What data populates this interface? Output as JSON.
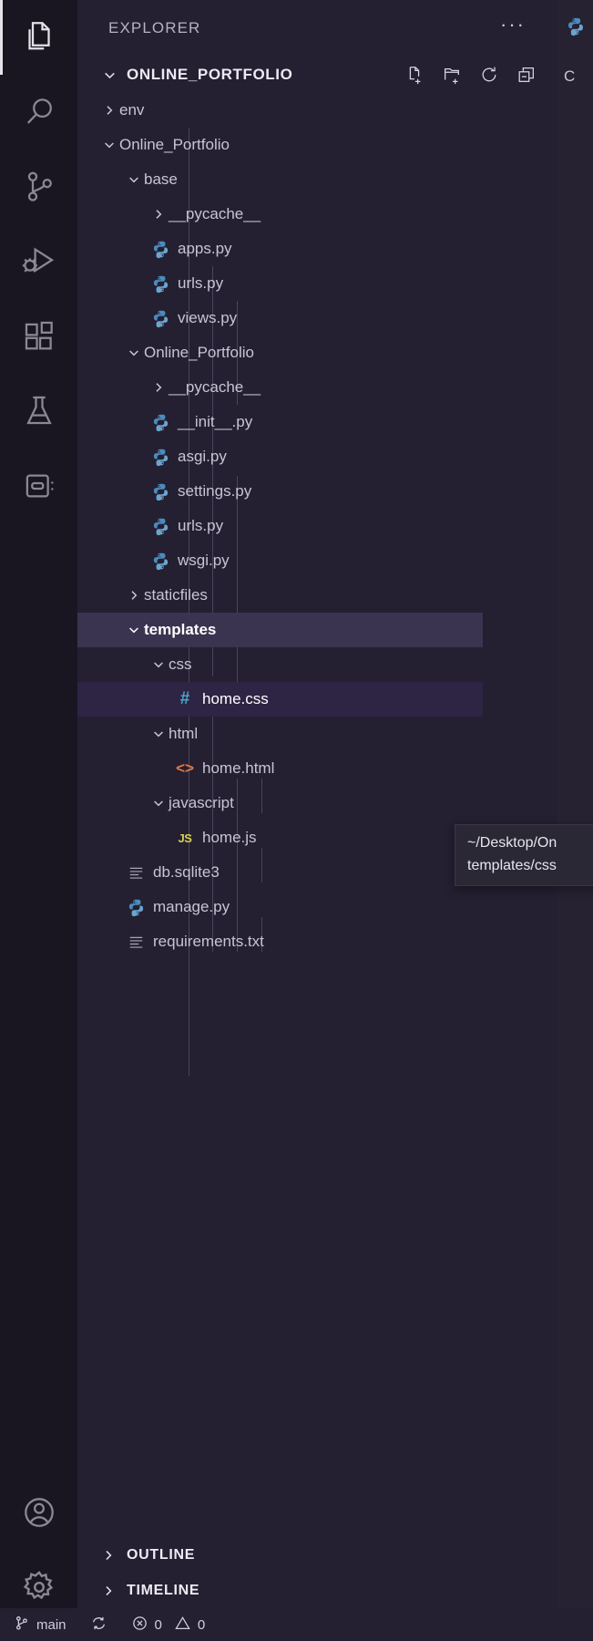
{
  "activitybar": {
    "items": [
      {
        "name": "explorer",
        "icon": "files-icon",
        "active": true
      },
      {
        "name": "search",
        "icon": "search-icon",
        "active": false
      },
      {
        "name": "source-control",
        "icon": "source-control-icon",
        "active": false
      },
      {
        "name": "run-and-debug",
        "icon": "run-debug-icon",
        "active": false
      },
      {
        "name": "extensions",
        "icon": "extensions-icon",
        "active": false
      },
      {
        "name": "testing",
        "icon": "beaker-icon",
        "active": false
      },
      {
        "name": "remote-explorer",
        "icon": "remote-explorer-icon",
        "active": false
      }
    ],
    "bottom": [
      {
        "name": "accounts",
        "icon": "account-icon"
      },
      {
        "name": "manage",
        "icon": "gear-icon"
      }
    ]
  },
  "sidebar": {
    "title": "EXPLORER",
    "more_actions": "···",
    "folder_section": {
      "label": "ONLINE_PORTFOLIO",
      "expanded": true,
      "actions": [
        {
          "name": "new-file-button",
          "icon": "new-file-icon"
        },
        {
          "name": "new-folder-button",
          "icon": "new-folder-icon"
        },
        {
          "name": "refresh-button",
          "icon": "refresh-icon"
        },
        {
          "name": "collapse-all-button",
          "icon": "collapse-all-icon"
        }
      ]
    },
    "tree": [
      {
        "label": "env",
        "type": "folder",
        "expanded": false,
        "depth": 1,
        "icon": "chevron-right-icon"
      },
      {
        "label": "Online_Portfolio",
        "type": "folder",
        "expanded": true,
        "depth": 1,
        "icon": "chevron-down-icon"
      },
      {
        "label": "base",
        "type": "folder",
        "expanded": true,
        "depth": 2,
        "icon": "chevron-down-icon"
      },
      {
        "label": "__pycache__",
        "type": "folder",
        "expanded": false,
        "depth": 3,
        "icon": "chevron-right-icon"
      },
      {
        "label": "apps.py",
        "type": "file",
        "depth": 3,
        "icon": "python-icon"
      },
      {
        "label": "urls.py",
        "type": "file",
        "depth": 3,
        "icon": "python-icon"
      },
      {
        "label": "views.py",
        "type": "file",
        "depth": 3,
        "icon": "python-icon"
      },
      {
        "label": "Online_Portfolio",
        "type": "folder",
        "expanded": true,
        "depth": 2,
        "icon": "chevron-down-icon"
      },
      {
        "label": "__pycache__",
        "type": "folder",
        "expanded": false,
        "depth": 3,
        "icon": "chevron-right-icon"
      },
      {
        "label": "__init__.py",
        "type": "file",
        "depth": 3,
        "icon": "python-icon"
      },
      {
        "label": "asgi.py",
        "type": "file",
        "depth": 3,
        "icon": "python-icon"
      },
      {
        "label": "settings.py",
        "type": "file",
        "depth": 3,
        "icon": "python-icon"
      },
      {
        "label": "urls.py",
        "type": "file",
        "depth": 3,
        "icon": "python-icon"
      },
      {
        "label": "wsgi.py",
        "type": "file",
        "depth": 3,
        "icon": "python-icon"
      },
      {
        "label": "staticfiles",
        "type": "folder",
        "expanded": false,
        "depth": 2,
        "icon": "chevron-right-icon"
      },
      {
        "label": "templates",
        "type": "folder",
        "expanded": true,
        "depth": 2,
        "icon": "chevron-down-icon",
        "state": "focused"
      },
      {
        "label": "css",
        "type": "folder",
        "expanded": true,
        "depth": 3,
        "icon": "chevron-down-icon"
      },
      {
        "label": "home.css",
        "type": "file",
        "depth": 4,
        "icon": "css-icon",
        "state": "selected"
      },
      {
        "label": "html",
        "type": "folder",
        "expanded": true,
        "depth": 3,
        "icon": "chevron-down-icon"
      },
      {
        "label": "home.html",
        "type": "file",
        "depth": 4,
        "icon": "html-icon"
      },
      {
        "label": "javascript",
        "type": "folder",
        "expanded": true,
        "depth": 3,
        "icon": "chevron-down-icon"
      },
      {
        "label": "home.js",
        "type": "file",
        "depth": 4,
        "icon": "js-icon"
      },
      {
        "label": "db.sqlite3",
        "type": "file",
        "depth": 2,
        "icon": "database-icon"
      },
      {
        "label": "manage.py",
        "type": "file",
        "depth": 2,
        "icon": "python-icon"
      },
      {
        "label": "requirements.txt",
        "type": "file",
        "depth": 2,
        "icon": "text-icon"
      }
    ],
    "panels": [
      {
        "label": "OUTLINE",
        "expanded": false,
        "icon": "chevron-right-icon"
      },
      {
        "label": "TIMELINE",
        "expanded": false,
        "icon": "chevron-right-icon"
      }
    ]
  },
  "tooltip": {
    "line1": "~/Desktop/On",
    "line2": "templates/css"
  },
  "statusbar": {
    "branch": "main",
    "branch_icon": "source-control-icon",
    "sync_icon": "sync-icon",
    "errors_icon": "error-icon",
    "errors": "0",
    "warnings_icon": "warning-icon",
    "warnings": "0"
  },
  "editor": {
    "tab_icon": "python-icon",
    "breadcrumb": "C"
  },
  "colors": {
    "activitybar_bg": "#191622",
    "sidebar_bg": "#241f31",
    "editor_bg": "#262232",
    "focused_row": "#3b3450",
    "selected_row": "#2e2444",
    "python_blue": "#5b9fd0",
    "css_blue": "#4aa8c7",
    "html_orange": "#e07a46",
    "js_yellow": "#d6d04c"
  }
}
